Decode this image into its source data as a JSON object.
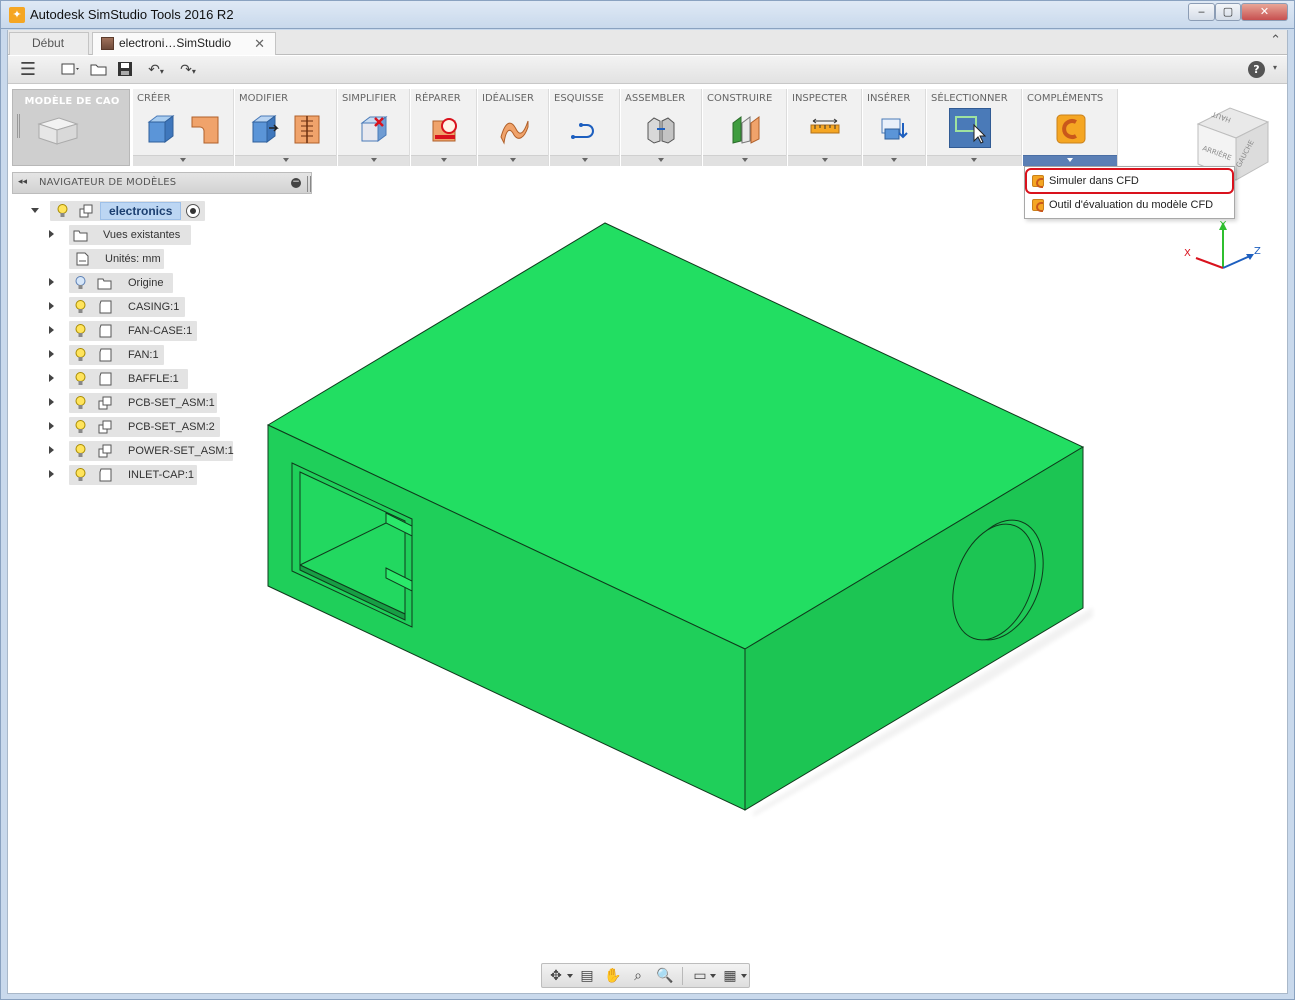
{
  "window": {
    "title": "Autodesk SimStudio Tools 2016 R2",
    "minimize_glyph": "‒",
    "maximize_glyph": "▢",
    "close_glyph": "✕"
  },
  "tabs": {
    "home_label": "Début",
    "active_label": "electroni…SimStudio",
    "close_glyph": "✕",
    "collapse_glyph": "⌃"
  },
  "quickbar": {
    "menu_glyph": "☰",
    "new_glyph": "▭",
    "open_glyph": "📂",
    "save_glyph": "💾",
    "undo_glyph": "↶",
    "redo_glyph": "↷",
    "help_glyph": "?"
  },
  "ribbon": {
    "workspace_label": "MODÈLE DE CAO",
    "groups": [
      {
        "label": "CRÉER"
      },
      {
        "label": "MODIFIER"
      },
      {
        "label": "SIMPLIFIER"
      },
      {
        "label": "RÉPARER"
      },
      {
        "label": "IDÉALISER"
      },
      {
        "label": "ESQUISSE"
      },
      {
        "label": "ASSEMBLER"
      },
      {
        "label": "CONSTRUIRE"
      },
      {
        "label": "INSPECTER"
      },
      {
        "label": "INSÉRER"
      },
      {
        "label": "SÉLECTIONNER"
      },
      {
        "label": "COMPLÉMENTS"
      }
    ]
  },
  "addins_menu": {
    "items": [
      {
        "label": "Simuler dans CFD",
        "icon": "cfd-icon",
        "highlighted": true
      },
      {
        "label": "Outil d'évaluation du modèle CFD",
        "icon": "cfd-icon",
        "highlighted": false
      }
    ]
  },
  "browser": {
    "title": "NAVIGATEUR DE MODÈLES",
    "collapse_glyph": "◂◂",
    "minus_glyph": "−",
    "root": {
      "label": "electronics"
    },
    "nodes": [
      {
        "label": "Vues existantes"
      },
      {
        "label": "Unités: mm"
      },
      {
        "label": "Origine"
      },
      {
        "label": "CASING:1"
      },
      {
        "label": "FAN-CASE:1"
      },
      {
        "label": "FAN:1"
      },
      {
        "label": "BAFFLE:1"
      },
      {
        "label": "PCB-SET_ASM:1"
      },
      {
        "label": "PCB-SET_ASM:2"
      },
      {
        "label": "POWER-SET_ASM:1"
      },
      {
        "label": "INLET-CAP:1"
      }
    ]
  },
  "viewcube": {
    "top_label": "HAUT",
    "back_label": "ARRIÈRE",
    "left_label": "GAUCHE"
  },
  "axes": {
    "x": "X",
    "y": "Y",
    "z": "Z"
  },
  "colors": {
    "model_front": "#1fcf5a",
    "model_top": "#22de62",
    "selection_blue": "#4a7ab8",
    "highlight_red": "#d9121d",
    "addin_orange": "#f5a623"
  },
  "navbar": {
    "orbit_glyph": "✥",
    "look_glyph": "▤",
    "pan_glyph": "✋",
    "zoom_glyph": "🔍",
    "fit_glyph": "⌕",
    "display_glyph": "▭",
    "grid_glyph": "▦"
  }
}
